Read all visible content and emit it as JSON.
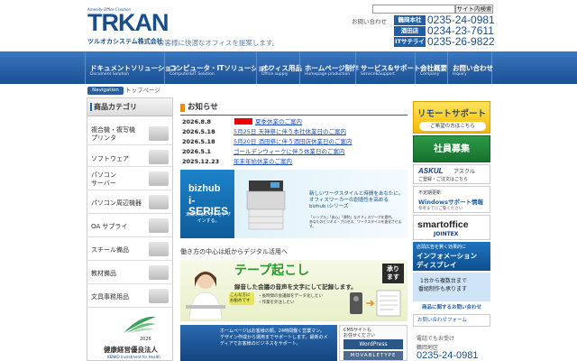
{
  "header": {
    "logo_tag": "Amenity Office Creation",
    "logo_brand": "TRKAN",
    "company": "ツルオカシステム株式会社",
    "tagline": "お客様に快適なオフィスを提案します。",
    "search_placeholder": "",
    "search_button": "サイト内検索",
    "contact_link": "お問い合わせ",
    "offices": [
      {
        "name": "鶴岡本社",
        "tel": "0235-24-0981"
      },
      {
        "name": "酒田店",
        "tel": "0234-23-7611"
      },
      {
        "name": "ITサテライト",
        "tel": "0235-26-9822"
      }
    ]
  },
  "nav": [
    {
      "jp": "ドキュメントソリューション",
      "en": "Document Solution"
    },
    {
      "jp": "コンピュータ・ITソリューション",
      "en": "Computer&IT Solution"
    },
    {
      "jp": "オフィス用品",
      "en": "Office supply"
    },
    {
      "jp": "ホームページ制作",
      "en": "Homepage production"
    },
    {
      "jp": "サービス&サポート",
      "en": "Service&Support"
    },
    {
      "jp": "会社概要",
      "en": "Company"
    },
    {
      "jp": "お問い合わせ",
      "en": "Inquiry"
    }
  ],
  "breadcrumb": {
    "label": "Navigation",
    "current": "トップページ"
  },
  "sidebar": {
    "title": "商品カテゴリ",
    "items": [
      {
        "line1": "複合機・複写機",
        "line2": "プリンタ"
      },
      {
        "line1": "ソフトウェア",
        "line2": ""
      },
      {
        "line1": "パソコン",
        "line2": "サーバー"
      },
      {
        "line1": "パソコン周辺機器",
        "line2": ""
      },
      {
        "line1": "OA サプライ",
        "line2": ""
      },
      {
        "line1": "スチール備品",
        "line2": ""
      },
      {
        "line1": "教材備品",
        "line2": ""
      },
      {
        "line1": "文具事務用品",
        "line2": ""
      }
    ],
    "seal": {
      "year": "2026",
      "title": "健康経営優良法人",
      "sub": "KENKO Investment for Health"
    }
  },
  "news": {
    "title": "お知らせ",
    "items": [
      {
        "date": "2026.8.8",
        "text": "夏季休業のご案内",
        "new": true
      },
      {
        "date": "2026.5.18",
        "text": "5月25日 天神祭に伴う本社休業日のご案内",
        "new": false
      },
      {
        "date": "2026.5.18",
        "text": "5月20日 酒田祭に伴う酒田店休業日のご案内",
        "new": false
      },
      {
        "date": "2026.5.1",
        "text": "ゴールデンウィークに伴う休業日のご案内",
        "new": false
      },
      {
        "date": "2025.12.23",
        "text": "年末年始休業のご案内",
        "new": false
      }
    ]
  },
  "bizhub": {
    "logo": "bizhub",
    "series": "i-SERIES",
    "catch": "未来のはたらくをデザインする。",
    "text1": "新しいワークスタイルと時間をあなたに。",
    "text2": "オフィスワーカーの創造性を高める",
    "text3": "bizhub iシリーズ",
    "note1": "「シンプル」「安心」「便利」なオフィスワークを提供。",
    "note2": "あなたのビジネス・プロセス、ワークスタイルを進化させます。"
  },
  "digital_caption": "働き方の中心は紙からデジタル活用へ",
  "tape": {
    "title": "テープ起こし",
    "badge1": "承り",
    "badge2": "ます",
    "sub": "録音した会議の音声を文字にして記録します。",
    "bubble": "こんな方にお勧めです",
    "point1": "・長時間の会議録をデータ化したい",
    "point2": "・作業を外注したい"
  },
  "homepage_banner": {
    "text": "ホームページはお客様の顔。24時間働く営業マン。デザイン作成から運用までサポートします。最新のメディアでお客様のビジネスをサポート。"
  },
  "cms": {
    "caption1": "CMSサイトも",
    "caption2": "お任せください",
    "wp": "WordPress",
    "mt": "MOVABLETYPE"
  },
  "right": {
    "remote_title": "リモートサポート",
    "remote_sub": "ご希望の方はこちら",
    "recruit": "社員募集",
    "askul_brand": "ASKUL",
    "askul_name": "アスクル",
    "askul_sub": "ご登録・ご注文はこちら",
    "windows_a": "不定期更新",
    "windows_b": "Windowsサポート情報",
    "windows_c": "参考までにご覧ください",
    "smart_a": "smartoffice",
    "smart_b": "JOINTEX",
    "display_a": "店頭広告を賢く効果的に",
    "display_b": "インフォメーション",
    "display_c": "ディスプレイ",
    "signage_a": "1台から複数台まで",
    "signage_b": "番組制作も承ります",
    "signage_c": "",
    "blog": "商品に関するお問い合わせ",
    "form": "お問い合わせフォーム",
    "phone_a": "電話でもお受け",
    "phone_b": "鶴岡地区",
    "phone_c": "0235-24-0981"
  }
}
